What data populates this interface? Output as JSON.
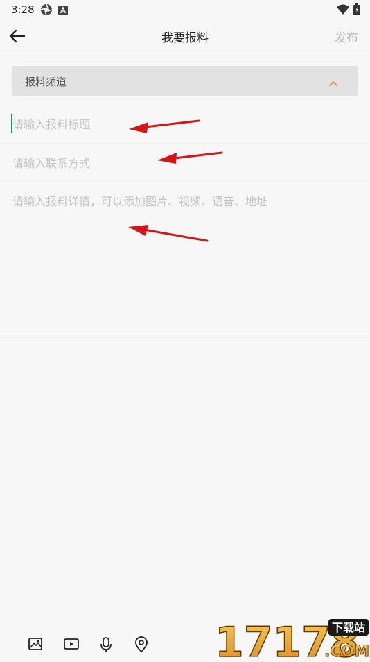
{
  "status_bar": {
    "time": "3:28"
  },
  "toolbar": {
    "title": "我要报料",
    "publish_label": "发布"
  },
  "form": {
    "channel_label": "报料频道",
    "title_placeholder": "请输入报料标题",
    "contact_placeholder": "请输入联系方式",
    "detail_placeholder": "请输入报料详情，可以添加图片、视频、语音、地址"
  },
  "bottom_tools": [
    "image-icon",
    "video-icon",
    "microphone-icon",
    "location-icon"
  ],
  "watermark": {
    "big_text": "17178",
    "tag": "下载站",
    "suffix": ".COM"
  },
  "colors": {
    "accent_chevron": "#f07c4a",
    "caret": "#2a8a78",
    "annotation_arrow": "#d81414"
  }
}
